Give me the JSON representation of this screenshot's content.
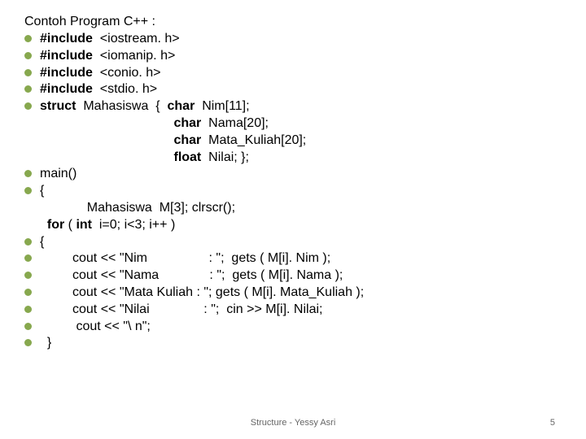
{
  "title": "Contoh Program C++ :",
  "lines": [
    {
      "bullet": true,
      "html": "<b>#include</b>  &lt;iostream. h&gt;"
    },
    {
      "bullet": true,
      "html": "<b>#include</b>  &lt;iomanip. h&gt;"
    },
    {
      "bullet": true,
      "html": "<b>#include</b>  &lt;conio. h&gt;"
    },
    {
      "bullet": true,
      "html": "<b>#include</b>  &lt;stdio. h&gt;"
    },
    {
      "bullet": true,
      "html": "<b>struct</b>  Mahasiswa  {  <b>char</b>  Nim[11];"
    },
    {
      "bullet": false,
      "html": "                                     <b>char</b>  Nama[20];"
    },
    {
      "bullet": false,
      "html": "                                     <b>char</b>  Mata_Kuliah[20];"
    },
    {
      "bullet": false,
      "html": "                                     <b>float</b>  Nilai; };"
    },
    {
      "bullet": true,
      "html": "main()"
    },
    {
      "bullet": true,
      "html": "{"
    },
    {
      "bullet": false,
      "html": "             Mahasiswa  M[3]; clrscr();"
    },
    {
      "bullet": false,
      "html": "  <b>for</b> ( <b>int</b>  i=0; i&lt;3; i++ )"
    },
    {
      "bullet": true,
      "html": "{"
    },
    {
      "bullet": true,
      "html": "         cout &lt;&lt; \"Nim                 : \";  gets ( M[i]. Nim );"
    },
    {
      "bullet": true,
      "html": "         cout &lt;&lt; \"Nama              : \";  gets ( M[i]. Nama );"
    },
    {
      "bullet": true,
      "html": "         cout &lt;&lt; \"Mata Kuliah : \"; gets ( M[i]. Mata_Kuliah );"
    },
    {
      "bullet": true,
      "html": "         cout &lt;&lt; \"Nilai               : \";  cin &gt;&gt; M[i]. Nilai;"
    },
    {
      "bullet": true,
      "html": "          cout &lt;&lt; \"\\ n\";"
    },
    {
      "bullet": true,
      "html": "  }"
    }
  ],
  "footer_center": "Structure - Yessy Asri",
  "footer_right": "5"
}
